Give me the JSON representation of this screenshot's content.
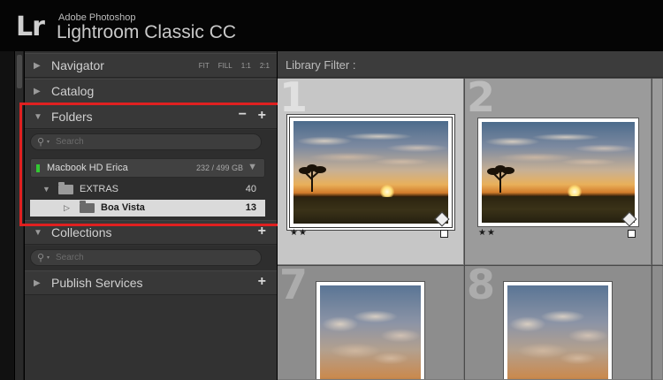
{
  "app": {
    "vendor": "Adobe Photoshop",
    "name": "Lightroom Classic CC",
    "logo": "Lr"
  },
  "navigator": {
    "title": "Navigator",
    "modes": [
      "FIT",
      "FILL",
      "1:1",
      "2:1"
    ]
  },
  "catalog": {
    "title": "Catalog"
  },
  "folders": {
    "title": "Folders",
    "minus": "−",
    "plus": "+",
    "search_placeholder": "Search",
    "volume": {
      "name": "Macbook HD Erica",
      "capacity": "232 / 499 GB",
      "status_color": "#32c832"
    },
    "items": [
      {
        "name": "EXTRAS",
        "count": "40",
        "expanded": true,
        "selected": false
      },
      {
        "name": "Boa Vista",
        "count": "13",
        "expanded": false,
        "selected": true
      }
    ]
  },
  "collections": {
    "title": "Collections",
    "plus": "+",
    "search_placeholder": "Search"
  },
  "publish_services": {
    "title": "Publish Services",
    "plus": "+"
  },
  "library_filter": {
    "label": "Library Filter :"
  },
  "grid": {
    "cells": [
      {
        "index": "1",
        "rating": "★★",
        "selected": true
      },
      {
        "index": "2",
        "rating": "★★",
        "selected": false
      },
      {
        "index": "7",
        "rating": "",
        "selected": false
      },
      {
        "index": "8",
        "rating": "",
        "selected": false
      }
    ]
  },
  "colors": {
    "highlight": "#e02020",
    "panel_bg": "#323232",
    "grid_bg": "#9b9b9b"
  }
}
